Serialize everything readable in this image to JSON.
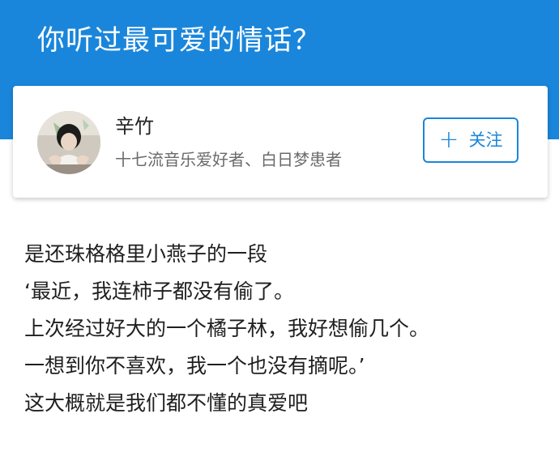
{
  "header": {
    "question_title": "你听过最可爱的情话？",
    "background_color": "#1a86db"
  },
  "author": {
    "name": "辛竹",
    "bio": "十七流音乐爱好者、白日梦患者",
    "avatar_icon": "user-avatar-photo",
    "follow_button": {
      "icon": "plus-icon",
      "plus_glyph": "+",
      "label": "关注"
    }
  },
  "answer": {
    "lines": [
      "是还珠格格里小燕子的一段",
      "‘最近，我连柿子都没有偷了。",
      "上次经过好大的一个橘子林，我好想偷几个。",
      "一想到你不喜欢，我一个也没有摘呢。’",
      "这大概就是我们都不懂的真爱吧"
    ]
  }
}
